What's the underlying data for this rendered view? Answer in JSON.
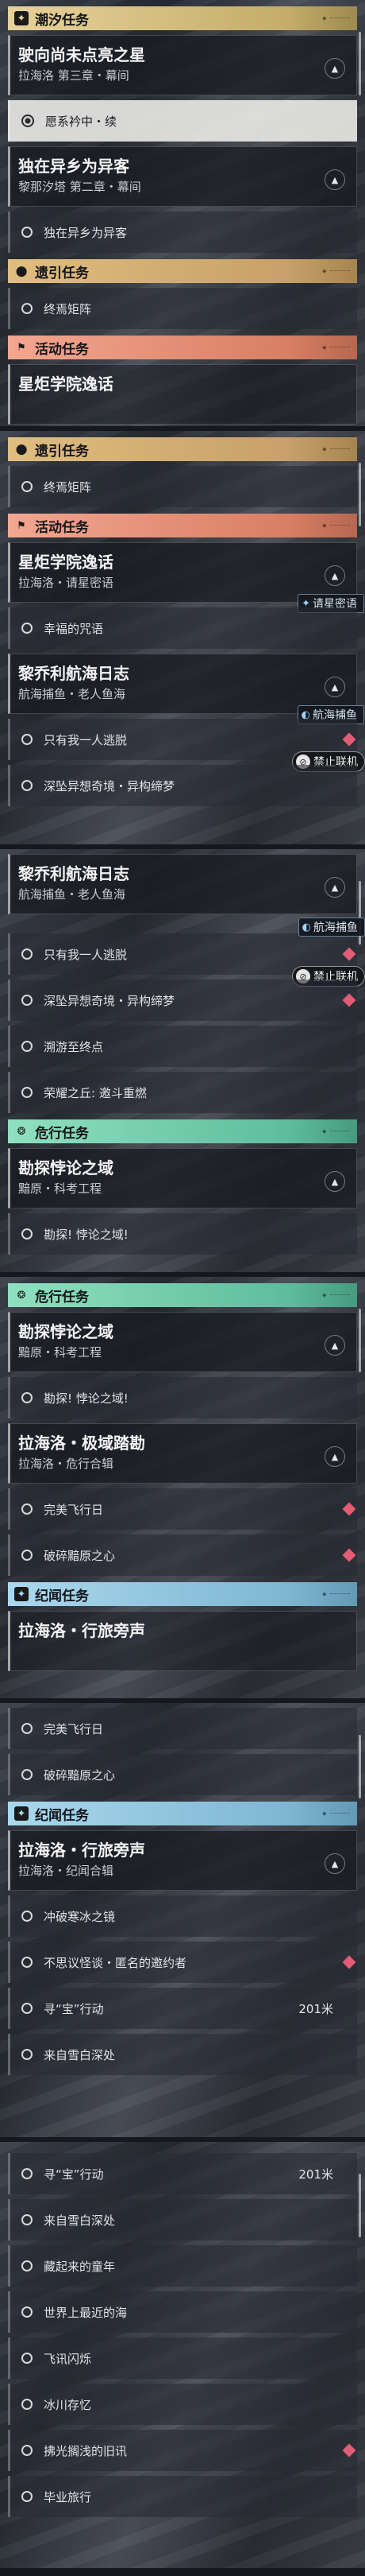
{
  "p1": {
    "cat_tidal": {
      "label": "潮汐任务",
      "icon": "star-icon"
    },
    "q_wuthering": {
      "title": "驶向尚未点亮之星",
      "subtitle": "拉海洛 第三章・幕间"
    },
    "t_follow": {
      "label": "愿系衿中・续"
    },
    "q_stranger": {
      "title": "独在异乡为异客",
      "subtitle": "黎那汐塔 第二章・幕间"
    },
    "t_stranger": {
      "label": "独在异乡为异客"
    },
    "cat_guide": {
      "label": "遗引任务",
      "icon": "map-pin-icon"
    },
    "t_terminus": {
      "label": "终焉矩阵"
    },
    "cat_event": {
      "label": "活动任务",
      "icon": "flag-icon"
    },
    "q_cut": {
      "title": "星炬学院逸话"
    }
  },
  "p2": {
    "cat_guide": {
      "label": "遗引任务"
    },
    "t_terminus": {
      "label": "终焉矩阵"
    },
    "cat_event": {
      "label": "活动任务"
    },
    "q_academy": {
      "title": "星炬学院逸话",
      "subtitle": "拉海洛・请星密语",
      "tag": "请星密语"
    },
    "t_spell": {
      "label": "幸福的咒语"
    },
    "q_log": {
      "title": "黎乔利航海日志",
      "subtitle": "航海捕鱼・老人鱼海",
      "tag": "航海捕鱼"
    },
    "t_alone": {
      "label": "只有我一人逃脱",
      "badge": "禁止联机"
    },
    "t_dream": {
      "label": "深坠异想奇境・异构缔梦"
    }
  },
  "p3": {
    "q_log": {
      "title": "黎乔利航海日志",
      "subtitle": "航海捕鱼・老人鱼海"
    },
    "t_alone": {
      "label": "只有我一人逃脱",
      "tag": "航海捕鱼",
      "badge": "禁止联机"
    },
    "t_dream": {
      "label": "深坠异想奇境・异构缔梦"
    },
    "t_tide": {
      "label": "溯游至终点"
    },
    "t_hill": {
      "label": "荣耀之丘: 邀斗重燃"
    },
    "cat_danger": {
      "label": "危行任务",
      "icon": "danger-icon"
    },
    "q_explore": {
      "title": "勘探悖论之域",
      "subtitle": "黯原・科考工程"
    },
    "t_paradox": {
      "label": "勘探! 悖论之域!"
    }
  },
  "p4": {
    "cat_danger": {
      "label": "危行任务"
    },
    "q_explore": {
      "title": "勘探悖论之域",
      "subtitle": "黯原・科考工程"
    },
    "t_paradox": {
      "label": "勘探! 悖论之域!"
    },
    "q_polar": {
      "title": "拉海洛・极域踏勘",
      "subtitle": "拉海洛・危行合辑"
    },
    "t_flight": {
      "label": "完美飞行日"
    },
    "t_heart": {
      "label": "破碎黯原之心"
    },
    "cat_journey": {
      "label": "纪闻任务",
      "icon": "journey-icon"
    },
    "q_travel": {
      "title": "拉海洛・行旅旁声"
    }
  },
  "p5": {
    "t_flight": {
      "label": "完美飞行日"
    },
    "t_heart": {
      "label": "破碎黯原之心"
    },
    "cat_journey": {
      "label": "纪闻任务"
    },
    "q_travel": {
      "title": "拉海洛・行旅旁声",
      "subtitle": "拉海洛・纪闻合辑"
    },
    "t_frost": {
      "label": "冲破寒冰之镜"
    },
    "t_invite": {
      "label": "不思议怪谈・匿名的邀约者"
    },
    "t_treasure": {
      "label": "寻“宝”行动",
      "distance": "201米"
    },
    "t_deep": {
      "label": "来自雪白深处"
    }
  },
  "p6": {
    "t_treasure": {
      "label": "寻“宝”行动",
      "distance": "201米"
    },
    "t_deep": {
      "label": "来自雪白深处"
    },
    "t_child": {
      "label": "藏起来的童年"
    },
    "t_nearest": {
      "label": "世界上最近的海"
    },
    "t_signal": {
      "label": "飞讯闪烁"
    },
    "t_ice": {
      "label": "冰川存忆"
    },
    "t_old": {
      "label": "拂光搁浅的旧讯"
    },
    "t_grad": {
      "label": "毕业旅行"
    }
  }
}
